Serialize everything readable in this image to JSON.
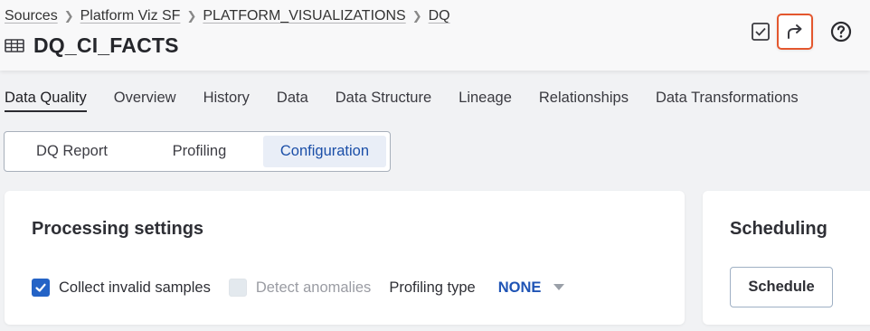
{
  "breadcrumb": [
    {
      "label": "Sources"
    },
    {
      "label": "Platform Viz SF"
    },
    {
      "label": "PLATFORM_VISUALIZATIONS"
    },
    {
      "label": "DQ"
    }
  ],
  "header": {
    "title": "DQ_CI_FACTS",
    "title_icon": "table-icon",
    "actions": [
      {
        "icon": "checkbox-check-icon"
      },
      {
        "icon": "share-arrow-icon",
        "highlighted": true
      },
      {
        "icon": "help-circle-icon"
      }
    ]
  },
  "tabs": [
    {
      "label": "Data Quality",
      "active": true
    },
    {
      "label": "Overview"
    },
    {
      "label": "History"
    },
    {
      "label": "Data"
    },
    {
      "label": "Data Structure"
    },
    {
      "label": "Lineage"
    },
    {
      "label": "Relationships"
    },
    {
      "label": "Data Transformations"
    }
  ],
  "subtabs": [
    {
      "label": "DQ Report"
    },
    {
      "label": "Profiling"
    },
    {
      "label": "Configuration",
      "active": true
    }
  ],
  "processing": {
    "title": "Processing settings",
    "collect_invalid_samples": {
      "label": "Collect invalid samples",
      "checked": true
    },
    "detect_anomalies": {
      "label": "Detect anomalies",
      "checked": false,
      "disabled": true
    },
    "profiling_type": {
      "label": "Profiling type",
      "value": "NONE"
    }
  },
  "scheduling": {
    "title": "Scheduling",
    "button_label": "Schedule"
  },
  "colors": {
    "accent": "#2463c6",
    "active_text": "#1b4fa8",
    "highlight_border": "#e4572e"
  }
}
